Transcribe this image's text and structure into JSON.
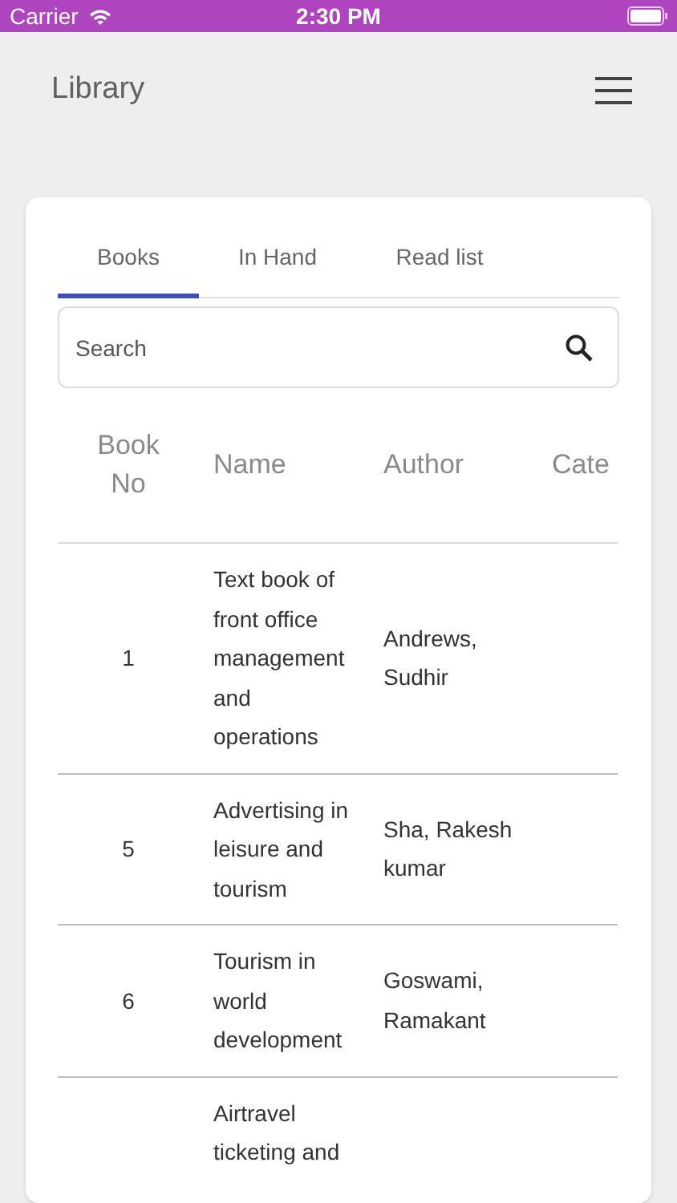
{
  "status_bar": {
    "carrier": "Carrier",
    "time": "2:30 PM"
  },
  "header": {
    "title": "Library"
  },
  "tabs": [
    {
      "label": "Books",
      "selected": true
    },
    {
      "label": "In Hand",
      "selected": false
    },
    {
      "label": "Read list",
      "selected": false
    }
  ],
  "search": {
    "placeholder": "Search"
  },
  "table": {
    "columns": [
      "Book No",
      "Name",
      "Author",
      "Cate"
    ],
    "rows": [
      {
        "book_no": "1",
        "name": "Text book of front office management and operations",
        "author": "Andrews, Sudhir"
      },
      {
        "book_no": "5",
        "name": "Advertising in leisure and tourism",
        "author": "Sha, Rakesh kumar"
      },
      {
        "book_no": "6",
        "name": "Tourism in world development",
        "author": "Goswami, Ramakant"
      },
      {
        "name": "Airtravel ticketing and"
      }
    ]
  }
}
